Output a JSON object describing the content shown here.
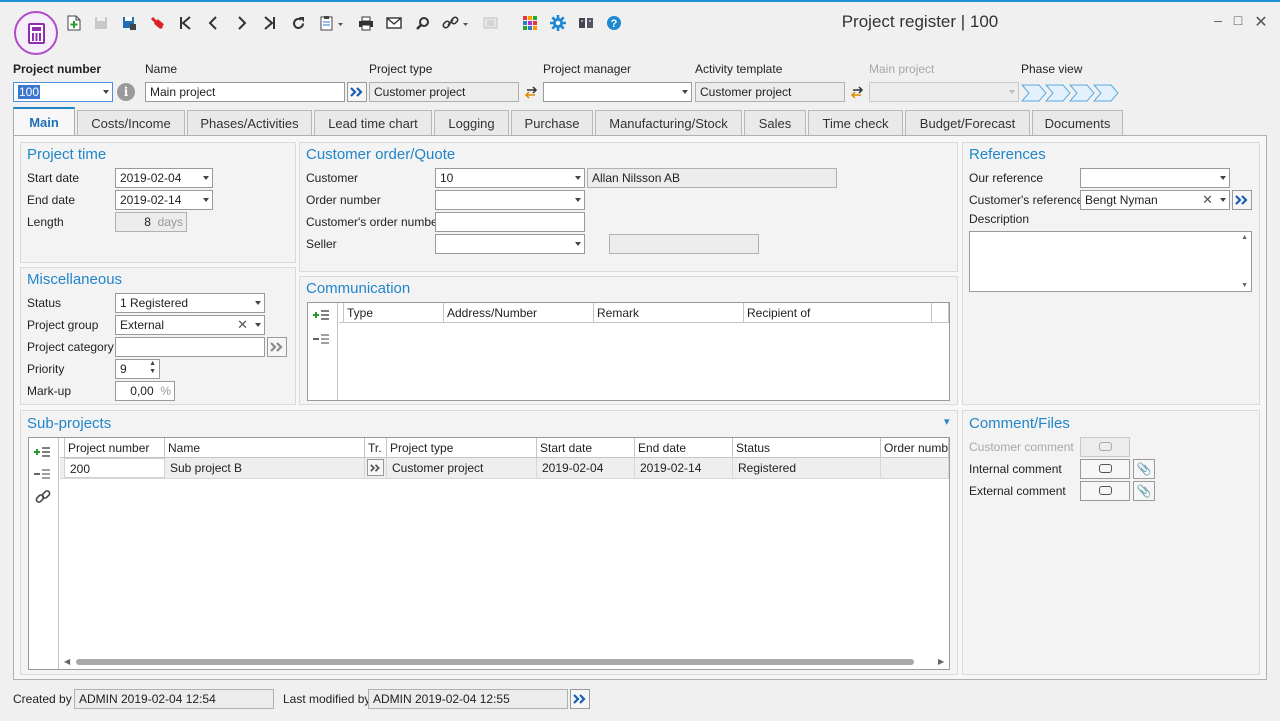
{
  "window": {
    "title": "Project register | 100",
    "minimize_icon": "minimize-icon",
    "maximize_icon": "maximize-icon",
    "close_icon": "close-icon"
  },
  "toolbar": {
    "icons": [
      "new-record-icon",
      "save-disabled-icon",
      "save-copy-icon",
      "delete-icon",
      "first-record-icon",
      "previous-record-icon",
      "next-record-icon",
      "last-record-icon",
      "refresh-icon",
      "clipboard-icon",
      "print-icon",
      "email-icon",
      "search-icon",
      "link-icon",
      "list-icon",
      "apps-grid-icon",
      "settings-icon",
      "book-icon",
      "help-icon"
    ]
  },
  "header": {
    "project_number_label": "Project number",
    "project_number_value": "100",
    "name_label": "Name",
    "name_value": "Main project",
    "project_type_label": "Project type",
    "project_type_value": "Customer project",
    "project_manager_label": "Project manager",
    "project_manager_value": "",
    "activity_template_label": "Activity template",
    "activity_template_value": "Customer project",
    "main_project_label": "Main project",
    "main_project_value": "",
    "phase_view_label": "Phase view"
  },
  "tabs": [
    {
      "label": "Main",
      "active": true
    },
    {
      "label": "Costs/Income"
    },
    {
      "label": "Phases/Activities"
    },
    {
      "label": "Lead time chart"
    },
    {
      "label": "Logging"
    },
    {
      "label": "Purchase"
    },
    {
      "label": "Manufacturing/Stock"
    },
    {
      "label": "Sales"
    },
    {
      "label": "Time check"
    },
    {
      "label": "Budget/Forecast"
    },
    {
      "label": "Documents"
    }
  ],
  "project_time": {
    "title": "Project time",
    "start_label": "Start date",
    "start_value": "2019-02-04",
    "end_label": "End date",
    "end_value": "2019-02-14",
    "length_label": "Length",
    "length_value": "8",
    "length_unit": "days"
  },
  "misc": {
    "title": "Miscellaneous",
    "status_label": "Status",
    "status_value": "1 Registered",
    "group_label": "Project group",
    "group_value": "External",
    "category_label": "Project category",
    "category_value": "",
    "priority_label": "Priority",
    "priority_value": "9",
    "markup_label": "Mark-up",
    "markup_value": "0,00",
    "markup_unit": "%"
  },
  "customer": {
    "title": "Customer order/Quote",
    "customer_label": "Customer",
    "customer_value": "10",
    "customer_name": "Allan Nilsson AB",
    "order_label": "Order number",
    "order_value": "",
    "cust_order_label": "Customer's order number",
    "cust_order_value": "",
    "seller_label": "Seller",
    "seller_value": "",
    "seller_name": ""
  },
  "communication": {
    "title": "Communication",
    "columns": [
      "Type",
      "Address/Number",
      "Remark",
      "Recipient of"
    ]
  },
  "references": {
    "title": "References",
    "our_label": "Our reference",
    "our_value": "",
    "cust_label": "Customer's reference",
    "cust_value": "Bengt Nyman",
    "desc_label": "Description",
    "desc_value": ""
  },
  "subprojects": {
    "title": "Sub-projects",
    "columns": [
      "Project number",
      "Name",
      "Tr.",
      "Project type",
      "Start date",
      "End date",
      "Status",
      "Order numbe"
    ],
    "rows": [
      {
        "number": "200",
        "name": "Sub project B",
        "type": "Customer project",
        "start": "2019-02-04",
        "end": "2019-02-14",
        "status": "Registered",
        "order": ""
      }
    ]
  },
  "comments": {
    "title": "Comment/Files",
    "customer_label": "Customer comment",
    "internal_label": "Internal comment",
    "external_label": "External comment"
  },
  "footer": {
    "created_label": "Created by",
    "created_value": "ADMIN 2019-02-04 12:54",
    "modified_label": "Last modified by",
    "modified_value": "ADMIN 2019-02-04 12:55"
  }
}
